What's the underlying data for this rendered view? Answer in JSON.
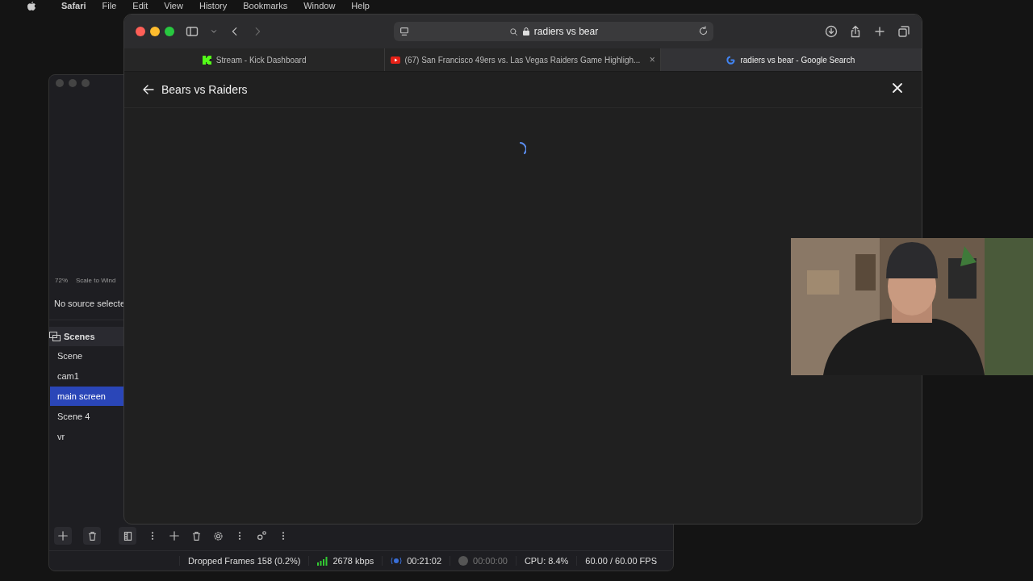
{
  "menu_bar": {
    "items": [
      "Safari",
      "File",
      "Edit",
      "View",
      "History",
      "Bookmarks",
      "Window",
      "Help"
    ]
  },
  "browser": {
    "address": "radiers vs bear",
    "tabs": [
      {
        "title": "Stream - Kick Dashboard",
        "selected": false,
        "kind": "kick"
      },
      {
        "title": "(67) San Francisco 49ers vs. Las Vegas Raiders Game Highligh...",
        "selected": false,
        "kind": "video",
        "close": "×"
      },
      {
        "title": "radiers vs bear - Google Search",
        "selected": true,
        "kind": "search"
      }
    ],
    "page": {
      "title": "Bears vs Raiders",
      "loading": true
    }
  },
  "obs": {
    "zoom": "72%",
    "scale_mode": "Scale to Wind",
    "source_properties": "No source selecte",
    "scenes": {
      "title": "Scenes",
      "items": [
        {
          "name": "Scene",
          "selected": false
        },
        {
          "name": "cam1",
          "selected": false
        },
        {
          "name": "main screen",
          "selected": true
        },
        {
          "name": "Scene 4",
          "selected": false
        },
        {
          "name": "vr",
          "selected": false
        }
      ]
    },
    "status_bar": {
      "dropped_frames": "Dropped Frames 158 (0.2%)",
      "bitrate": "2678 kbps",
      "stream_time": "00:21:02",
      "record_time": "00:00:00",
      "cpu": "CPU: 8.4%",
      "fps": "60.00 / 60.00 FPS"
    }
  }
}
